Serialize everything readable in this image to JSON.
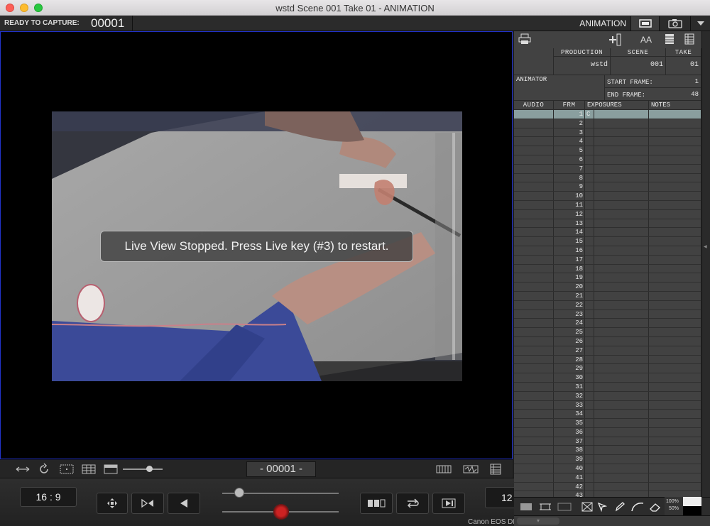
{
  "window": {
    "title": "wstd  Scene 001  Take 01 - ANIMATION"
  },
  "toolbar": {
    "status_label": "READY TO CAPTURE:",
    "frame_counter": "00001",
    "mode_label": "ANIMATION",
    "icons": [
      "monitor-icon",
      "camera-icon",
      "dropdown-arrow-icon"
    ]
  },
  "viewer": {
    "message": "Live View Stopped. Press Live key (#3) to restart.",
    "frame_box": "- 00001 -"
  },
  "controls": {
    "aspect_ratio": "16 : 9",
    "fps_value": "12",
    "camera_label": "Canon EOS DIG"
  },
  "sheet": {
    "header": {
      "production_label": "PRODUCTION",
      "scene_label": "SCENE",
      "take_label": "TAKE",
      "production_value": "wstd",
      "scene_value": "001",
      "take_value": "01",
      "animator_label": "ANIMATOR",
      "start_frame_label": "START FRAME:",
      "start_frame_value": "1",
      "end_frame_label": "END FRAME:",
      "end_frame_value": "48"
    },
    "columns": {
      "audio": "AUDIO",
      "frm": "FRM",
      "exposures": "EXPOSURES",
      "notes": "NOTES"
    },
    "rows": [
      {
        "frm": "1",
        "exp": "C"
      },
      {
        "frm": "2",
        "exp": ""
      },
      {
        "frm": "3",
        "exp": ""
      },
      {
        "frm": "4",
        "exp": ""
      },
      {
        "frm": "5",
        "exp": ""
      },
      {
        "frm": "6",
        "exp": ""
      },
      {
        "frm": "7",
        "exp": ""
      },
      {
        "frm": "8",
        "exp": ""
      },
      {
        "frm": "9",
        "exp": ""
      },
      {
        "frm": "10",
        "exp": ""
      },
      {
        "frm": "11",
        "exp": ""
      },
      {
        "frm": "12",
        "exp": ""
      },
      {
        "frm": "13",
        "exp": ""
      },
      {
        "frm": "14",
        "exp": ""
      },
      {
        "frm": "15",
        "exp": ""
      },
      {
        "frm": "16",
        "exp": ""
      },
      {
        "frm": "17",
        "exp": ""
      },
      {
        "frm": "18",
        "exp": ""
      },
      {
        "frm": "19",
        "exp": ""
      },
      {
        "frm": "20",
        "exp": ""
      },
      {
        "frm": "21",
        "exp": ""
      },
      {
        "frm": "22",
        "exp": ""
      },
      {
        "frm": "23",
        "exp": ""
      },
      {
        "frm": "24",
        "exp": ""
      },
      {
        "frm": "25",
        "exp": ""
      },
      {
        "frm": "26",
        "exp": ""
      },
      {
        "frm": "27",
        "exp": ""
      },
      {
        "frm": "28",
        "exp": ""
      },
      {
        "frm": "29",
        "exp": ""
      },
      {
        "frm": "30",
        "exp": ""
      },
      {
        "frm": "31",
        "exp": ""
      },
      {
        "frm": "32",
        "exp": ""
      },
      {
        "frm": "33",
        "exp": ""
      },
      {
        "frm": "34",
        "exp": ""
      },
      {
        "frm": "35",
        "exp": ""
      },
      {
        "frm": "36",
        "exp": ""
      },
      {
        "frm": "37",
        "exp": ""
      },
      {
        "frm": "38",
        "exp": ""
      },
      {
        "frm": "39",
        "exp": ""
      },
      {
        "frm": "40",
        "exp": ""
      },
      {
        "frm": "41",
        "exp": ""
      },
      {
        "frm": "42",
        "exp": ""
      },
      {
        "frm": "43",
        "exp": ""
      }
    ],
    "selected_row": 0,
    "tool_text": {
      "font_size": "AA",
      "zoom_100": "100%",
      "zoom_50": "50%"
    }
  }
}
